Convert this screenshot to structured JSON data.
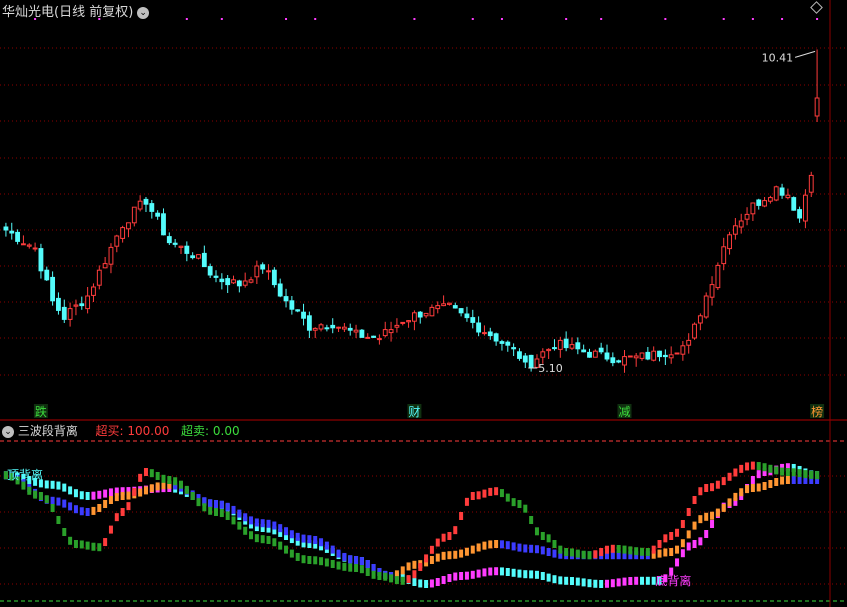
{
  "header": {
    "title": "华灿光电(日线 前复权)",
    "indicator_name": "三波段背离",
    "overbought_label": "超买:",
    "overbought_value": "100.00",
    "oversold_label": "超卖:",
    "oversold_value": "0.00"
  },
  "colors": {
    "up": "#ff3c3c",
    "down": "#54fcfc",
    "grid": "#8b0000",
    "divider": "#b00000",
    "text": "#c0c0c0",
    "red_label": "#ff3c3c",
    "green_label": "#3cdc3c",
    "magenta": "#ff3cff"
  },
  "chart_data": [
    {
      "type": "candlestick",
      "price_range": [
        4.5,
        11.0
      ],
      "annotations": [
        {
          "label": "10.41",
          "index": 139,
          "price": 10.41,
          "kind": "high"
        },
        {
          "label": "5.10",
          "index": 89,
          "price": 5.1,
          "kind": "low"
        }
      ],
      "event_markers": [
        {
          "label": "跌",
          "index": 6,
          "color": "#3cdc3c"
        },
        {
          "label": "财",
          "index": 70,
          "color": "#54fcfc"
        },
        {
          "label": "减",
          "index": 106,
          "color": "#3cdc3c"
        },
        {
          "label": "榜",
          "index": 139,
          "color": "#ff9632"
        }
      ],
      "top_dot_indices": [
        5,
        16,
        31,
        37,
        48,
        53,
        70,
        80,
        85,
        96,
        102,
        113,
        123,
        128,
        133,
        139
      ],
      "candles": []
    },
    {
      "type": "indicator",
      "title": "三波段背离",
      "range": [
        0,
        100
      ],
      "annotations": [
        {
          "label": "顶背离",
          "index": 3,
          "value": 78,
          "color": "#54fcfc"
        },
        {
          "label": "底背离",
          "index": 113,
          "value": 12,
          "color": "#ff3cff"
        }
      ]
    }
  ]
}
